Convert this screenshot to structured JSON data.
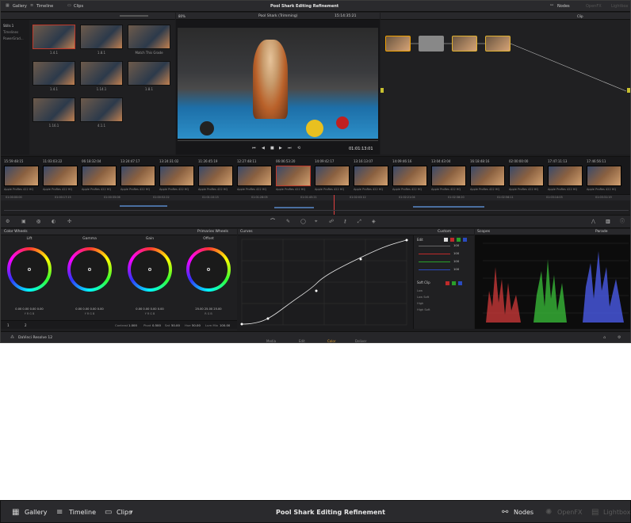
{
  "app": {
    "title": "Pool Shark Editing Refinement",
    "name": "DaVinci Resolve 12",
    "topbar": {
      "gallery": "Gallery",
      "timeline": "Timeline",
      "clips": "Clips",
      "nodes": "Nodes",
      "openfx": "OpenFX",
      "lightbox": "Lightbox"
    }
  },
  "viewer": {
    "zoom": "80%",
    "title": "Pool Shark (Trimming)",
    "timecode": "15:14:35:21",
    "playhead_tc": "01:01:13:01",
    "clip_label": "Clip"
  },
  "gallery": {
    "sidebar": [
      "Stills 1",
      "Timelines",
      "PowerGrad..."
    ],
    "stills": [
      {
        "label": "1.4.1"
      },
      {
        "label": "1.8.1"
      },
      {
        "label": "Match This Grade"
      },
      {
        "label": "1.4.1"
      },
      {
        "label": "1.14.1"
      },
      {
        "label": "1.8.1"
      },
      {
        "label": "1.16.1"
      },
      {
        "label": "4.1.1"
      }
    ]
  },
  "clips": [
    {
      "num": "01",
      "tc": "15:59:48:15",
      "track": "V1",
      "fmt": "Apple ProRes 422 HQ"
    },
    {
      "num": "02",
      "tc": "11:03:03:22",
      "track": "V1",
      "fmt": "Apple ProRes 422 HQ"
    },
    {
      "num": "03",
      "tc": "06:18:32:04",
      "track": "V1",
      "fmt": "Apple ProRes 422 HQ"
    },
    {
      "num": "04",
      "tc": "13:24:47:17",
      "track": "V1",
      "fmt": "Apple ProRes 422 HQ"
    },
    {
      "num": "05",
      "tc": "13:24:31:02",
      "track": "V1",
      "fmt": "Apple ProRes 422 HQ"
    },
    {
      "num": "06",
      "tc": "11:26:45:19",
      "track": "V1",
      "fmt": "Apple ProRes 422 HQ"
    },
    {
      "num": "07",
      "tc": "12:27:48:11",
      "track": "V1",
      "fmt": "Apple ProRes 422 HQ"
    },
    {
      "num": "08",
      "tc": "06:06:53:20",
      "track": "V1",
      "fmt": "Apple ProRes 422 HQ"
    },
    {
      "num": "09",
      "tc": "14:09:42:17",
      "track": "V1",
      "fmt": "Apple ProRes 422 HQ"
    },
    {
      "num": "10",
      "tc": "13:16:13:07",
      "track": "V1",
      "fmt": "Apple ProRes 422 HQ"
    },
    {
      "num": "11",
      "tc": "14:09:46:16",
      "track": "V1",
      "fmt": "Apple ProRes 422 HQ"
    },
    {
      "num": "12",
      "tc": "13:04:43:04",
      "track": "V1",
      "fmt": "Apple ProRes 422 HQ"
    },
    {
      "num": "13",
      "tc": "16:18:48:16",
      "track": "V1",
      "fmt": "Apple ProRes 422 HQ"
    },
    {
      "num": "14",
      "tc": "02:00:00:00",
      "track": "V1",
      "fmt": "Apple ProRes 422 HQ"
    },
    {
      "num": "15",
      "tc": "17:47:11:13",
      "track": "V1",
      "fmt": "Apple ProRes 422 HQ"
    },
    {
      "num": "16",
      "tc": "17:46:56:11",
      "track": "V1",
      "fmt": "Apple ProRes 422 HQ"
    }
  ],
  "ruler": [
    "01:00:00:00",
    "01:00:17:15",
    "01:00:35:06",
    "01:00:52:22",
    "01:01:10:13",
    "01:01:28:05",
    "01:01:45:21",
    "01:02:03:12",
    "01:02:21:04",
    "01:02:38:20",
    "01:02:56:11",
    "01:03:14:03",
    "01:03:31:19"
  ],
  "color_wheels": {
    "title": "Color Wheels",
    "mode": "Primaries Wheels",
    "wheels": [
      {
        "name": "Lift",
        "vals": "0.00  0.00  0.00  0.00",
        "sub": "Y    R    G    B"
      },
      {
        "name": "Gamma",
        "vals": "0.00  0.00  0.00  0.00",
        "sub": "Y    R    G    B"
      },
      {
        "name": "Gain",
        "vals": "0.00  0.00  0.00  0.00",
        "sub": "Y    R    G    B"
      },
      {
        "name": "Offset",
        "vals": "25.00  25.00  25.00",
        "sub": "R    G    B"
      }
    ],
    "footer": {
      "contrast_label": "Contrast",
      "contrast": "1.000",
      "pivot_label": "Pivot",
      "pivot": "0.500",
      "sat_label": "Sat",
      "sat": "50.00",
      "hue_label": "Hue",
      "hue": "50.00",
      "lummix_label": "Lum Mix",
      "lummix": "100.00"
    },
    "pages": [
      "1",
      "2"
    ]
  },
  "curves": {
    "title": "Curves",
    "mode": "Custom",
    "edit_label": "Edit",
    "values": [
      "100",
      "100",
      "100",
      "100"
    ],
    "softclip_title": "Soft Clip",
    "softclip_rows": [
      "Low",
      "Low Soft",
      "High",
      "High Soft"
    ]
  },
  "scopes": {
    "title": "Scopes",
    "mode": "Parade"
  },
  "pages": [
    "Media",
    "Edit",
    "Color",
    "Deliver"
  ],
  "strip": {
    "gallery": "Gallery",
    "timeline": "Timeline",
    "clips": "Clips",
    "title": "Pool Shark Editing Refinement",
    "nodes": "Nodes",
    "openfx": "OpenFX",
    "lightbox": "Lightbox"
  },
  "accent": "#c0392b"
}
